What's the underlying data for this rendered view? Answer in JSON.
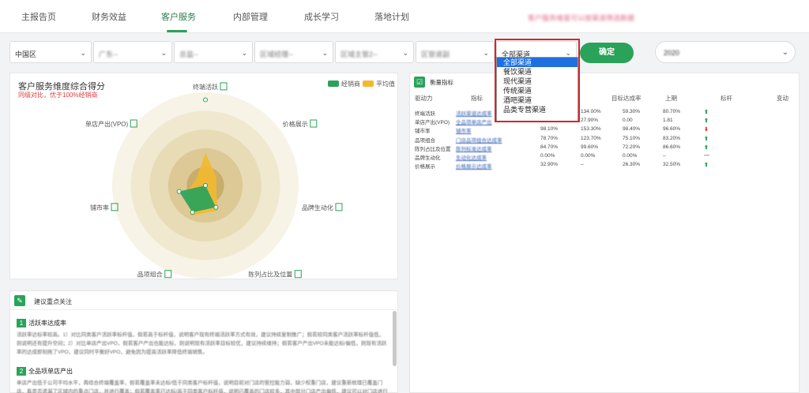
{
  "topnav": {
    "tabs": [
      "主报告页",
      "财务效益",
      "客户服务",
      "内部管理",
      "成长学习",
      "落地计划"
    ],
    "active_tab": "客户服务",
    "blurred_notice": "客户服务维度可以按渠道筛选数据"
  },
  "filters": {
    "region": "中国区",
    "f2": "广东--",
    "f3": "总监--",
    "f4": "区域经理--",
    "f5": "区域主管2--",
    "f6": "区管道副",
    "channel": "全部渠道",
    "confirm_label": "确定",
    "date": "2020"
  },
  "channel_dropdown": {
    "options": [
      "全部渠道",
      "餐饮渠道",
      "现代渠道",
      "传统渠道",
      "酒吧渠道",
      "品类专营渠道"
    ],
    "highlighted": "全部渠道"
  },
  "radar": {
    "title": "客户服务维度综合得分",
    "subtitle": "同级对比，优于100%经销商",
    "legend": [
      {
        "label": "经销商",
        "color": "#2aa35a"
      },
      {
        "label": "平均值",
        "color": "#f2b930"
      }
    ]
  },
  "chart_data": {
    "type": "radar",
    "axes": [
      "终端活跃",
      "价格展示",
      "品牌生动化",
      "陈列占比及位置",
      "品项组合",
      "铺市率",
      "单店产出(VPO)"
    ],
    "series": [
      {
        "name": "经销商",
        "values": [
          0.92,
          0.0,
          0.0,
          0.26,
          0.32,
          0.29,
          0.0
        ]
      },
      {
        "name": "平均值",
        "values": [
          0.35,
          0.15,
          0.12,
          0.3,
          0.36,
          0.18,
          0.12
        ]
      }
    ],
    "range": [
      0,
      1
    ]
  },
  "advice": {
    "title": "建议重点关注",
    "items": [
      {
        "num": "1",
        "title": "活跃率达成率",
        "body": "活跃率达标率较高。1）对比同类客户活跃率标杆值，假若高于标杆值，说明客户现有终端活跃率方式有效，建议持续复制推广；假若较同类客户活跃率标杆值低，则说明还有提升空间；2）对比单店产出VPO，假若客户产出也能达标，则说明现有活跃率目标较优，建议持续维持；假若客户产出VPO未能达标/偏低，则现有活跃率的达成即刻拖了VPO，建议同时平衡好VPO，避免因为提高活跃率降低终端销售。"
      },
      {
        "num": "2",
        "title": "全品项单店产出",
        "body": "单店产出低于公司平均水平，再结合终端覆盖率，假若覆盖率未达标/低于同类客户标杆值，说明目前对门店的管控能力弱，缺少权重门店，建议重新梳理已覆盖门店，看是否遗漏了区域内的重点门店，并进行覆盖；假若覆盖率已达标/高于同类客户标杆值，说明已覆盖的门店较多，其中部分门店产出偏低，建议可以对门店进行精细排"
      }
    ]
  },
  "kpi_table": {
    "title": "衡量指标",
    "columns": [
      "驱动力",
      "指标",
      "目标达成率",
      "上期",
      "标杆",
      "变动"
    ],
    "rows": [
      {
        "driver": "终端活跃",
        "indicator": "活跃渠道达成率",
        "v1": "",
        "v2": "134.00%",
        "target": "59.30%",
        "prev": "80.70%",
        "trend": "up"
      },
      {
        "driver": "单店产出(VPO)",
        "indicator": "全品项单店产出",
        "v1": "",
        "v2": "27.90%",
        "target": "0.00",
        "prev": "1.81",
        "trend": "up"
      },
      {
        "driver": "铺市率",
        "indicator": "铺市率",
        "v1": "98.10%",
        "v2": "153.30%",
        "target": "98.40%",
        "prev": "96.60%",
        "trend": "down"
      },
      {
        "driver": "品项组合",
        "indicator": "门店品项组合达成率",
        "v1": "78.70%",
        "v2": "123.70%",
        "target": "75.10%",
        "prev": "83.20%",
        "trend": "up"
      },
      {
        "driver": "陈列占比及位置",
        "indicator": "陈列标准达成率",
        "v1": "84.70%",
        "v2": "99.60%",
        "target": "72.20%",
        "prev": "86.60%",
        "trend": "up"
      },
      {
        "driver": "品牌生动化",
        "indicator": "生动化达成率",
        "v1": "0.00%",
        "v2": "0.00%",
        "target": "0.00%",
        "prev": "–",
        "trend": "flat"
      },
      {
        "driver": "价格展示",
        "indicator": "价格展示达成率",
        "v1": "32.90%",
        "v2": "–",
        "target": "26.30%",
        "prev": "32.50%",
        "trend": "up"
      }
    ],
    "trend_colors": {
      "up": "#2aa35a",
      "down": "#e23b3b",
      "flat": "#777777"
    }
  }
}
